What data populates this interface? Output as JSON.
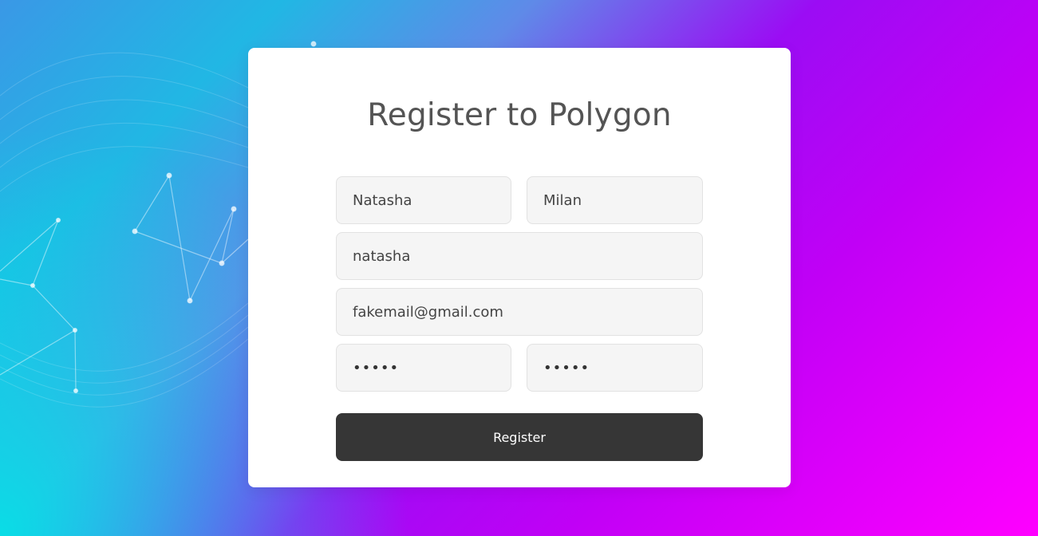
{
  "page": {
    "title": "Register to Polygon"
  },
  "form": {
    "first_name": "Natasha",
    "last_name": "Milan",
    "username": "natasha",
    "email": "fakemail@gmail.com",
    "password": "•••••",
    "confirm_password": "•••••"
  },
  "actions": {
    "register_label": "Register"
  },
  "colors": {
    "card_background": "#ffffff",
    "title_text": "#545454",
    "field_background": "#f5f5f5",
    "button_background": "#363636"
  }
}
